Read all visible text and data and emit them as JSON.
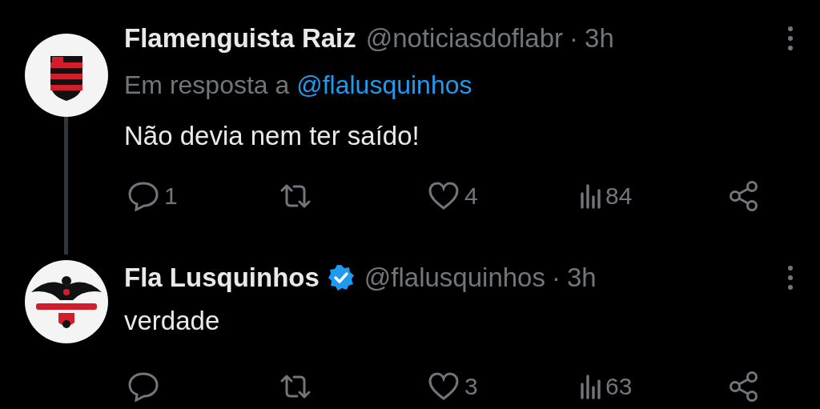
{
  "posts": [
    {
      "avatar": {
        "kind": "crest"
      },
      "name": "Flamenguista Raiz",
      "verified": false,
      "handle": "@noticiasdoflabr",
      "separator": "·",
      "time": "3h",
      "reply_to": {
        "prefix": "Em resposta a",
        "handle": "@flalusquinhos"
      },
      "text": "Não devia nem ter saído!",
      "thread_line": true,
      "actions": [
        {
          "kind": "reply",
          "count": "1"
        },
        {
          "kind": "repost"
        },
        {
          "kind": "like",
          "count": "4"
        },
        {
          "kind": "views",
          "count": "84"
        },
        {
          "kind": "share"
        }
      ]
    },
    {
      "avatar": {
        "kind": "bird"
      },
      "name": "Fla Lusquinhos",
      "verified": true,
      "handle": "@flalusquinhos",
      "separator": "·",
      "time": "3h",
      "text": "verdade",
      "thread_line": false,
      "actions": [
        {
          "kind": "reply"
        },
        {
          "kind": "repost"
        },
        {
          "kind": "like",
          "count": "3"
        },
        {
          "kind": "views",
          "count": "63"
        },
        {
          "kind": "share"
        }
      ]
    }
  ]
}
